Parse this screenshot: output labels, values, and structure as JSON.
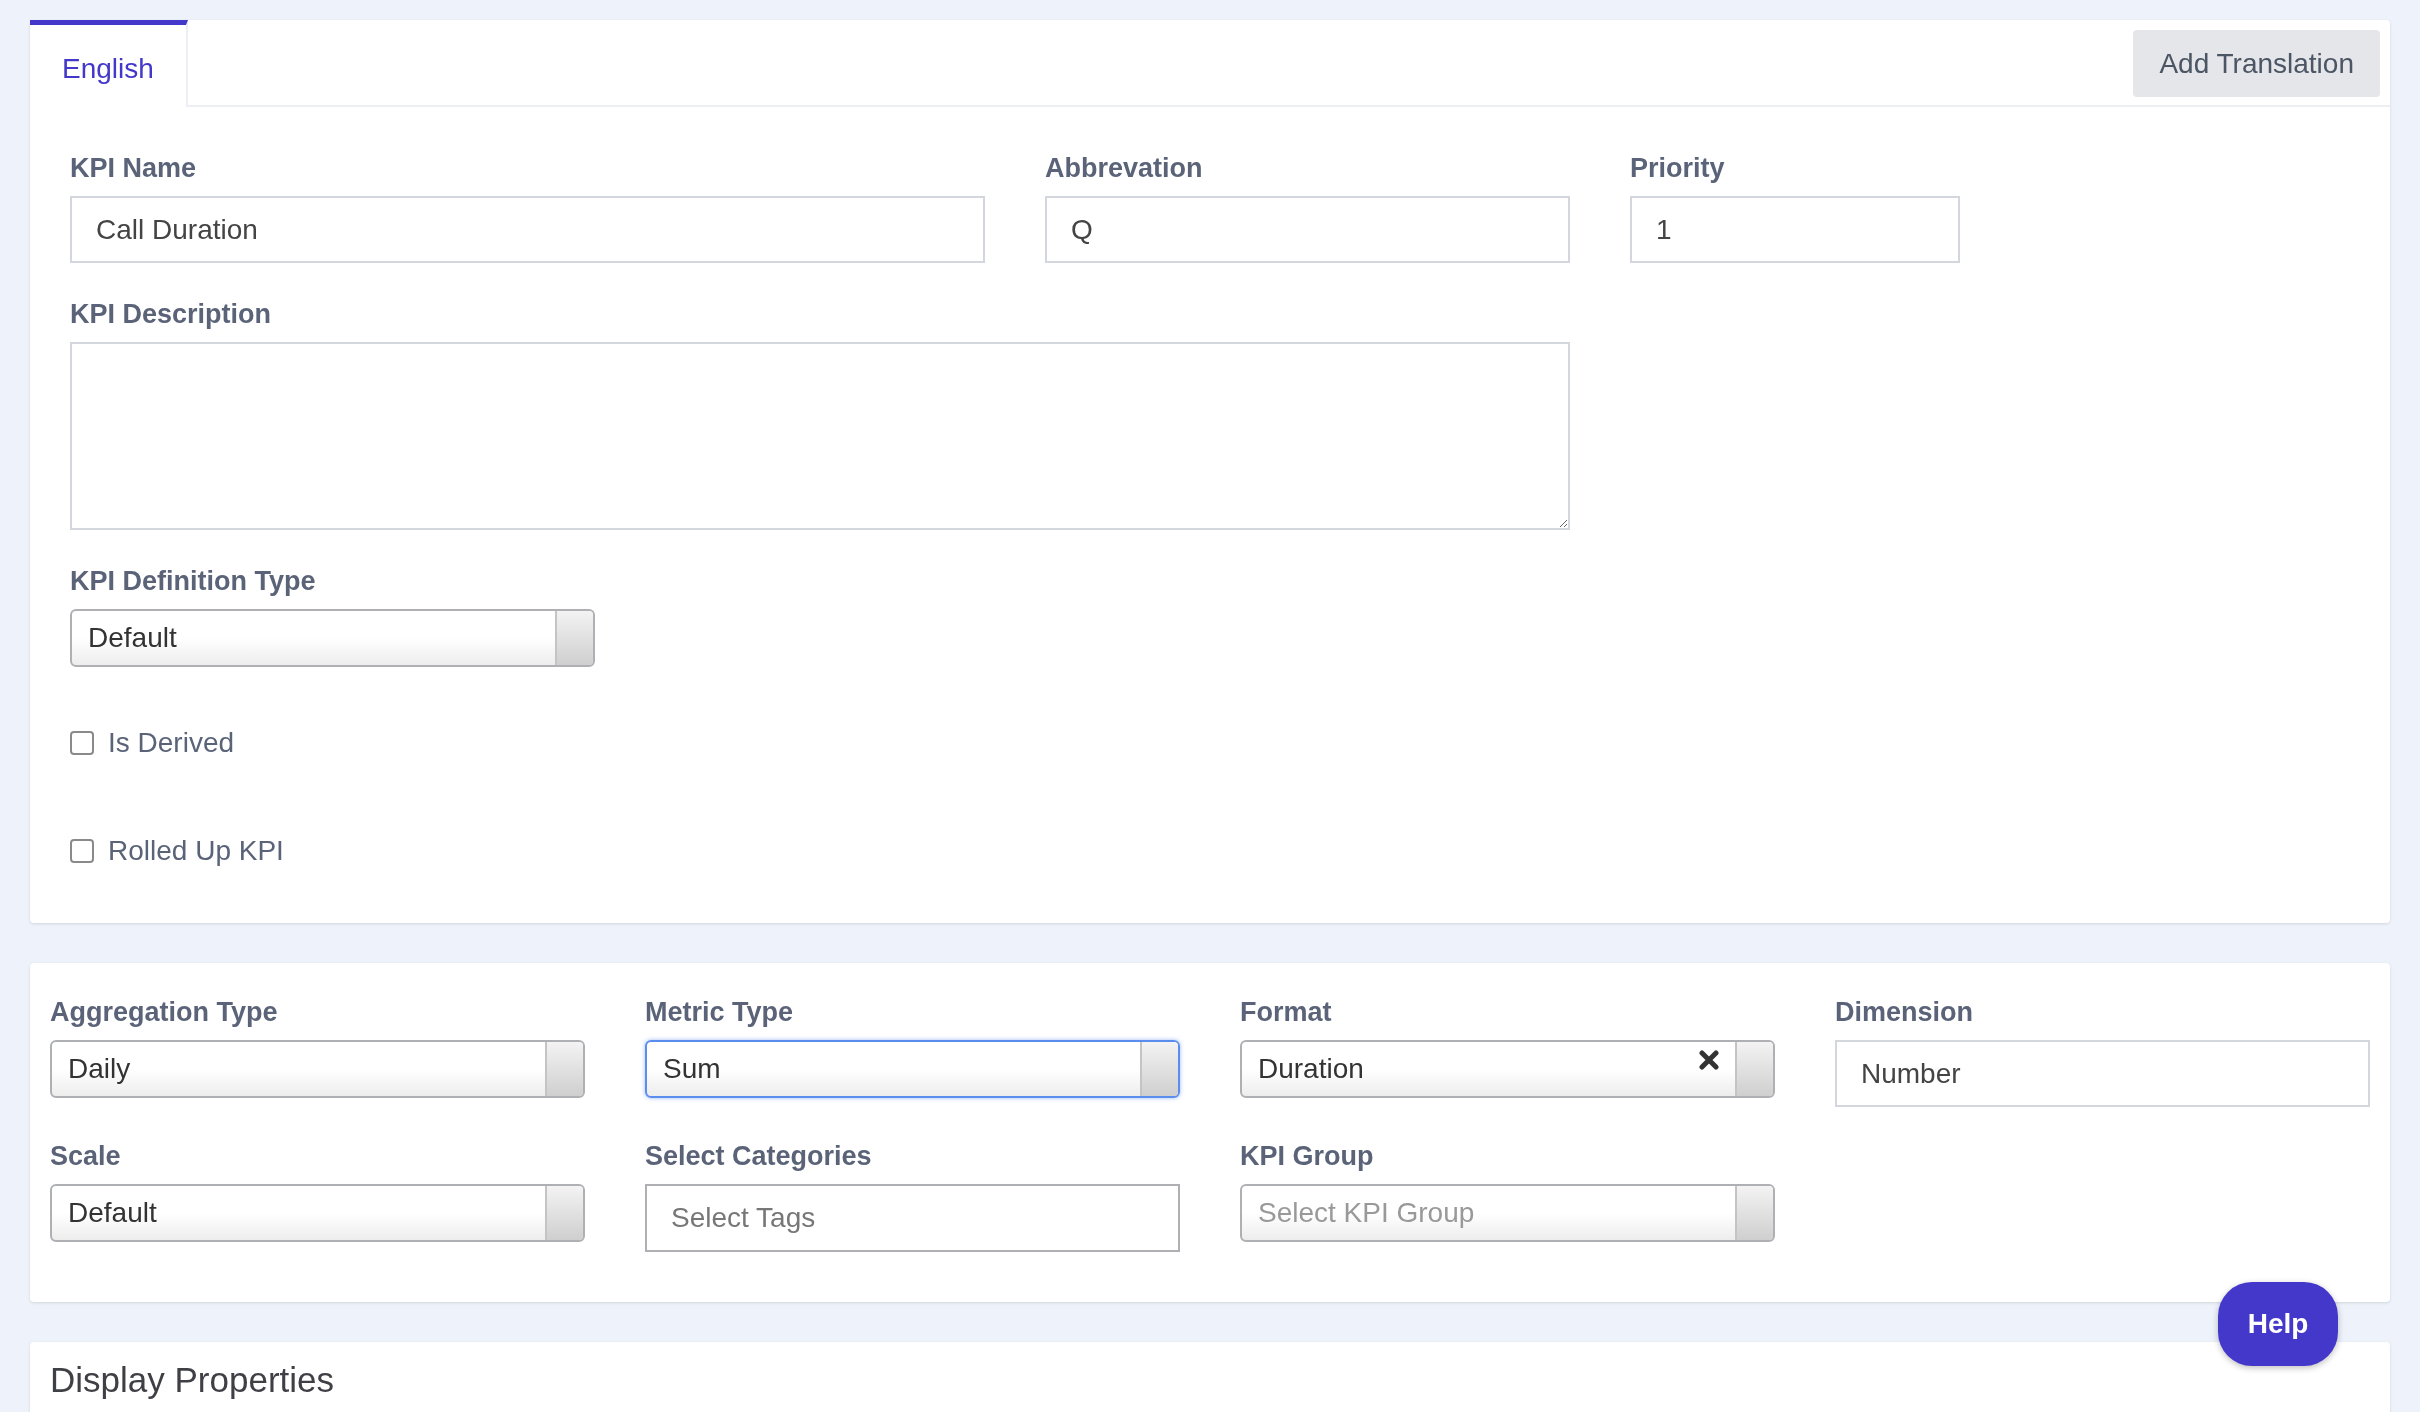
{
  "tabs": [
    {
      "label": "English",
      "selected": true
    }
  ],
  "add_translation_button": "Add Translation",
  "general": {
    "top_row": [
      {
        "label": "KPI Name",
        "value": "Call Duration"
      },
      {
        "label": "Abbrevation",
        "value": "Q"
      },
      {
        "label": "Priority",
        "value": "1"
      }
    ],
    "description": {
      "label": "KPI Description"
    },
    "definition_type": {
      "label": "KPI Definition Type",
      "value": "Default"
    },
    "checkboxes": [
      {
        "label": "Is Derived",
        "checked": false
      },
      {
        "label": "Rolled Up KPI",
        "checked": false
      }
    ]
  },
  "settings": {
    "fields": [
      {
        "kind": "select",
        "label": "Aggregation Type",
        "value": "Daily",
        "focused": false,
        "clearable": false
      },
      {
        "kind": "select",
        "label": "Metric Type",
        "value": "Sum",
        "focused": true,
        "clearable": false
      },
      {
        "kind": "select",
        "label": "Format",
        "value": "Duration",
        "focused": false,
        "clearable": true
      },
      {
        "kind": "text",
        "label": "Dimension",
        "value": "Number"
      },
      {
        "kind": "select",
        "label": "Scale",
        "value": "Default",
        "focused": false,
        "clearable": false
      },
      {
        "kind": "tags",
        "label": "Select Categories",
        "placeholder": "Select Tags"
      },
      {
        "kind": "select",
        "label": "KPI Group",
        "placeholder": "Select KPI Group",
        "focused": false,
        "clearable": false
      }
    ]
  },
  "display_properties": {
    "title": "Display Properties"
  },
  "help_button": "Help"
}
